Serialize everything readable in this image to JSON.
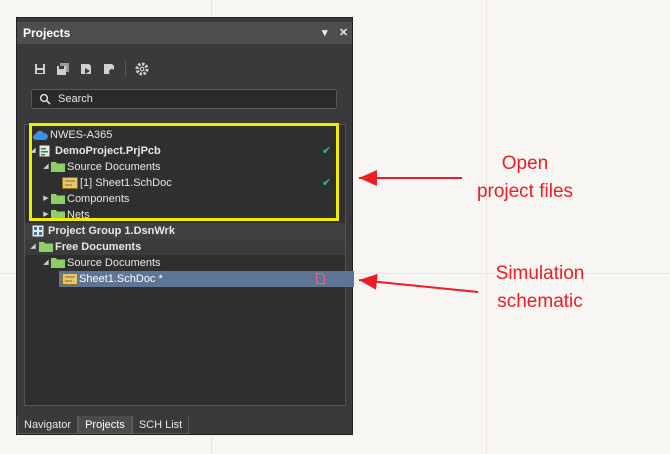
{
  "panel": {
    "title": "Projects",
    "pin_glyph": "▾",
    "close_glyph": "✕",
    "toolbar": [
      {
        "name": "save-icon"
      },
      {
        "name": "save-all-icon"
      },
      {
        "name": "compile-icon"
      },
      {
        "name": "close-project-icon"
      },
      {
        "name": "gear-icon"
      }
    ],
    "search_placeholder": "Search"
  },
  "tree": {
    "workspace": "NWES-A365",
    "project": "DemoProject.PrjPcb",
    "source_documents": "Source Documents",
    "project_sheet": "[1] Sheet1.SchDoc",
    "components": "Components",
    "nets": "Nets",
    "project_group": "Project Group 1.DsnWrk",
    "free_documents": "Free Documents",
    "free_source_documents": "Source Documents",
    "free_sheet": "Sheet1.SchDoc *",
    "check_glyph": "✔"
  },
  "tabs": [
    {
      "label": "Navigator"
    },
    {
      "label": "Projects"
    },
    {
      "label": "SCH List"
    }
  ],
  "annotations": {
    "open_project_line1": "Open",
    "open_project_line2": "project files",
    "simulation_line1": "Simulation",
    "simulation_line2": "schematic"
  },
  "colors": {
    "highlight": "#f1ed00",
    "annotation": "#ee1c25",
    "selected_row": "#5e7695",
    "check": "#33c37f"
  }
}
